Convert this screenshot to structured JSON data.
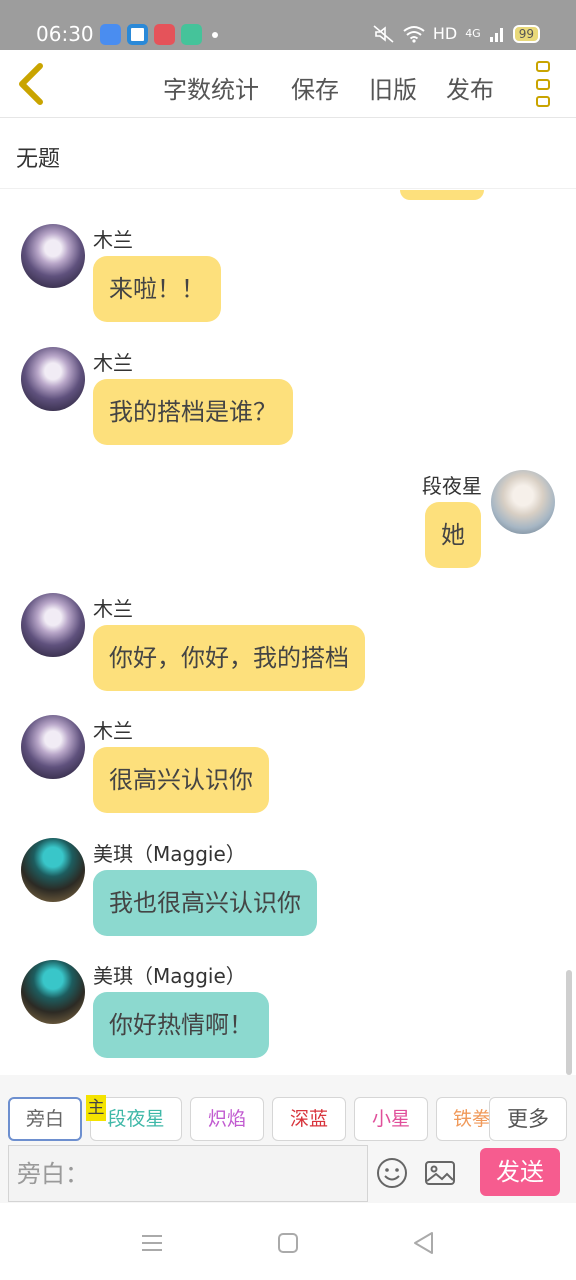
{
  "status_bar": {
    "time": "06:30",
    "network": "HD",
    "signal": "4G",
    "battery": "99",
    "app_icons": [
      {
        "name": "cloud-app-icon",
        "color": "#4a8df0"
      },
      {
        "name": "camera-app-icon",
        "color": "#2a89d8"
      },
      {
        "name": "multi-app-icon",
        "color": "#e5535a"
      },
      {
        "name": "green-app-icon",
        "color": "#45c39a"
      }
    ]
  },
  "header": {
    "back_icon": "chevron-left-icon",
    "actions": [
      "字数统计",
      "保存",
      "旧版",
      "发布"
    ],
    "menu_icon": "more-vertical-icon"
  },
  "doc": {
    "title": "无题"
  },
  "messages": [
    {
      "sender": "木兰",
      "text": "来啦！！",
      "side": "left",
      "color": "yellow",
      "avatar": "mulan-avatar"
    },
    {
      "sender": "木兰",
      "text": "我的搭档是谁？",
      "side": "left",
      "color": "yellow",
      "avatar": "mulan-avatar"
    },
    {
      "sender": "段夜星",
      "text": "她",
      "side": "right",
      "color": "yellow",
      "avatar": "duanyexing-avatar"
    },
    {
      "sender": "木兰",
      "text": "你好，你好，我的搭档",
      "side": "left",
      "color": "yellow",
      "avatar": "mulan-avatar"
    },
    {
      "sender": "木兰",
      "text": "很高兴认识你",
      "side": "left",
      "color": "yellow",
      "avatar": "mulan-avatar"
    },
    {
      "sender": "美琪（Maggie）",
      "text": "我也很高兴认识你",
      "side": "left",
      "color": "teal",
      "avatar": "maggie-avatar"
    },
    {
      "sender": "美琪（Maggie）",
      "text": "你好热情啊！",
      "side": "left",
      "color": "teal",
      "avatar": "maggie-avatar"
    }
  ],
  "characters": {
    "chips": [
      {
        "label": "旁白",
        "color": "#666666"
      },
      {
        "label": "段夜星",
        "color": "#3fb8a8"
      },
      {
        "label": "炽焰",
        "color": "#c15ad0"
      },
      {
        "label": "深蓝",
        "color": "#d8343c"
      },
      {
        "label": "小星",
        "color": "#e04f9a"
      },
      {
        "label": "铁拳",
        "color": "#f09a5b"
      }
    ],
    "main_mark": "主",
    "more_label": "更多"
  },
  "composer": {
    "placeholder": "旁白：",
    "emoji_icon": "emoji-icon",
    "image_icon": "image-icon",
    "send_label": "发送",
    "send_color": "#f65c8f"
  },
  "nav": [
    "menu-icon",
    "home-icon",
    "back-triangle-icon"
  ],
  "colors": {
    "accent": "#c9a400",
    "bubble_yellow": "#fde07c",
    "bubble_teal": "#8cd9cf"
  }
}
